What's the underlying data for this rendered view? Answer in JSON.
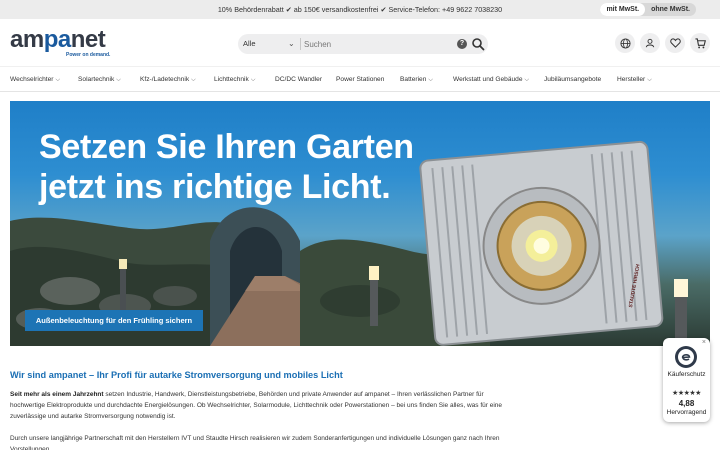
{
  "topbar": {
    "promo": "10% Behördenrabatt ✔ ab 150€ versandkostenfrei ✔ Service-Telefon: +49 9622 7038230",
    "vat_on": "mit MwSt.",
    "vat_off": "ohne MwSt."
  },
  "header": {
    "logo_am": "am",
    "logo_pa": "pa",
    "logo_net": "net",
    "logo_tagline": "Power on demand.",
    "search": {
      "category": "Alle",
      "placeholder": "Suchen"
    },
    "icons": [
      "globe-icon",
      "user-icon",
      "heart-icon",
      "cart-icon"
    ]
  },
  "nav": {
    "items": [
      {
        "label": "Wechselrichter"
      },
      {
        "label": "Solartechnik"
      },
      {
        "label": "Kfz-/Ladetechnik"
      },
      {
        "label": "Lichttechnik"
      },
      {
        "label": "DC/DC Wandler"
      },
      {
        "label": "Power Stationen"
      },
      {
        "label": "Batterien"
      },
      {
        "label": "Werkstatt und Gebäude"
      },
      {
        "label": "Jubiläumsangebote"
      },
      {
        "label": "Hersteller"
      }
    ]
  },
  "hero": {
    "title_line1": "Setzen Sie Ihren Garten",
    "title_line2": "jetzt ins richtige Licht.",
    "cta": "Außenbeleuchtung für den Frühling sichern",
    "product_label": "STAUDTE HIRSCH"
  },
  "content": {
    "heading": "Wir sind ampanet – Ihr Profi für autarke Stromversorgung und mobiles Licht",
    "p1_bold": "Seit mehr als einem Jahrzehnt",
    "p1_rest": " setzen Industrie, Handwerk, Dienstleistungsbetriebe, Behörden und private Anwender auf ampanet – Ihren verlässlichen Partner für hochwertige Elektroprodukte und durchdachte Energielösungen. Ob Wechselrichter, Solarmodule, Lichttechnik oder Powerstationen – bei uns finden Sie alles, was für eine zuverlässige und autarke Stromversorgung notwendig ist.",
    "p2": "Durch unsere langjährige Partnerschaft mit den Herstellern IVT und Staudte Hirsch realisieren wir zudem Sonderanfertigungen und individuelle Lösungen ganz nach Ihren Vorstellungen."
  },
  "trust_badge": {
    "close": "×",
    "label": "Käuferschutz",
    "stars": "★★★★★",
    "score": "4,88",
    "rating_word": "Hervorragend"
  },
  "colors": {
    "brand_blue": "#1b6fb4",
    "cta_blue": "#1d74b5",
    "logo_dark": "#343a46"
  }
}
